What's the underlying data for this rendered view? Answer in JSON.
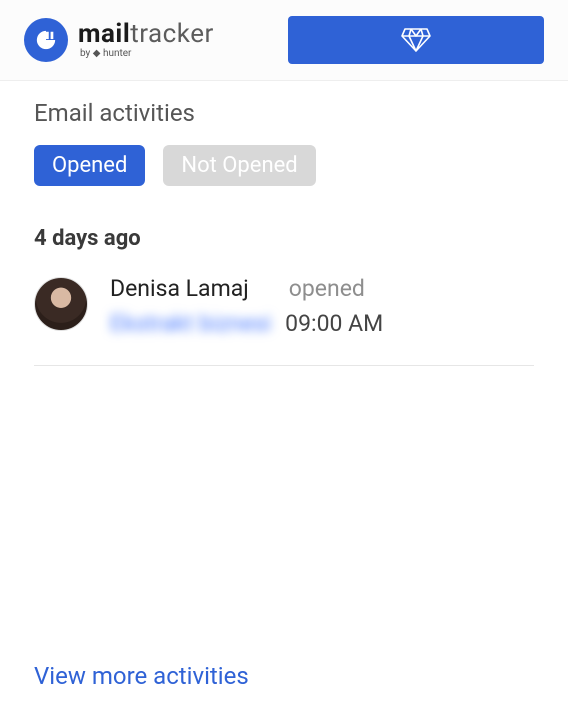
{
  "header": {
    "brand_bold": "mail",
    "brand_light": "tracker",
    "brand_sub": "by ◆ hunter"
  },
  "section": {
    "title": "Email activities"
  },
  "tabs": {
    "opened": "Opened",
    "not_opened": "Not Opened"
  },
  "group": {
    "label": "4 days ago"
  },
  "activity": {
    "name": "Denisa Lamaj",
    "status": "opened",
    "subject": "Ekstrakt biznesi",
    "time": "09:00 AM"
  },
  "footer": {
    "view_more": "View more activities"
  }
}
